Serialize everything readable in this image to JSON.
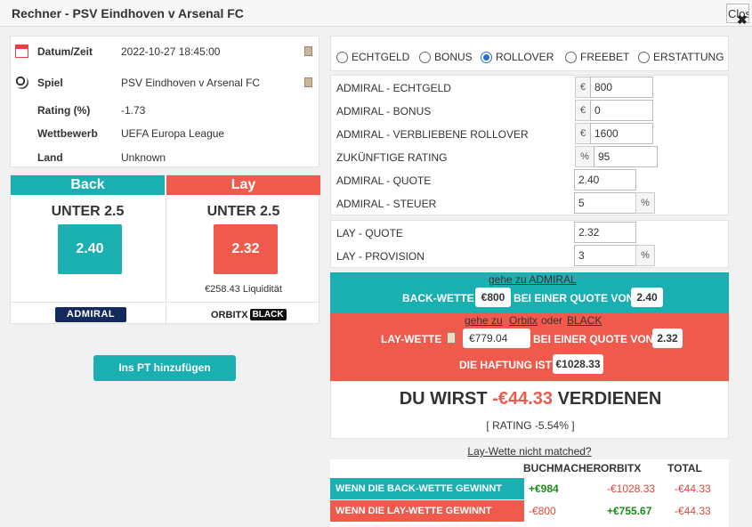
{
  "window": {
    "title": "Rechner - PSV Eindhoven v Arsenal FC",
    "close_label": "Close",
    "close_x": "✖"
  },
  "info": {
    "rows": [
      {
        "label": "Datum/Zeit",
        "value": "2022-10-27 18:45:00"
      },
      {
        "label": "Spiel",
        "value": "PSV Eindhoven v Arsenal FC"
      },
      {
        "label": "Rating (%)",
        "value": "-1.73"
      },
      {
        "label": "Wettbewerb",
        "value": "UEFA Europa League"
      },
      {
        "label": "Land",
        "value": "Unknown"
      }
    ]
  },
  "back": {
    "header": "Back",
    "market": "UNTER 2.5",
    "odds": "2.40",
    "bookmaker": "ADMIRAL"
  },
  "lay": {
    "header": "Lay",
    "market": "UNTER 2.5",
    "odds": "2.32",
    "liquidity": "€258.43 Liquidität",
    "exchange": "ORBITX",
    "exchange_x": "X",
    "exchange_black": "BLACK"
  },
  "pt_button": "Ins PT hinzufügen",
  "radios": [
    {
      "label": "ECHTGELD",
      "checked": false
    },
    {
      "label": "BONUS",
      "checked": false
    },
    {
      "label": "ROLLOVER",
      "checked": true
    },
    {
      "label": "FREEBET",
      "checked": false
    },
    {
      "label": "ERSTATTUNG",
      "checked": false
    }
  ],
  "form": {
    "echtgeld_label": "ADMIRAL - ECHTGELD",
    "echtgeld_addon": "€",
    "echtgeld_value": "800",
    "bonus_label": "ADMIRAL - BONUS",
    "bonus_addon": "€",
    "bonus_value": "0",
    "rollover_label": "ADMIRAL - VERBLIEBENE ROLLOVER",
    "rollover_addon": "€",
    "rollover_value": "1600",
    "rating_label": "ZUKÜNFTIGE RATING",
    "rating_addon": "%",
    "rating_value": "95",
    "quote_label": "ADMIRAL - QUOTE",
    "quote_value": "2.40",
    "steuer_label": "ADMIRAL - STEUER",
    "steuer_value": "5",
    "steuer_addon": "%",
    "lay_quote_label": "LAY - QUOTE",
    "lay_quote_value": "2.32",
    "provision_label": "LAY - PROVISION",
    "provision_value": "3",
    "provision_addon": "%"
  },
  "back_bet": {
    "link": "gehe zu ADMIRAL",
    "prefix": "BACK-WETTE",
    "stake": "€800",
    "middle": "BEI EINER QUOTE VON",
    "odds": "2.40"
  },
  "lay_bet": {
    "link_prefix": "gehe zu",
    "link_orbitx": "Orbitx",
    "link_or": "oder",
    "link_black": "BLACK",
    "prefix": "LAY-WETTE",
    "stake": "€779.04",
    "middle": "BEI EINER QUOTE VON",
    "odds": "2.32",
    "liability_label": "DIE HAFTUNG IST",
    "liability": "€1028.33"
  },
  "result": {
    "prefix": "DU WIRST",
    "amount": "-€44.33",
    "suffix": "VERDIENEN",
    "rating": "[ RATING -5.54% ]"
  },
  "not_matched": "Lay-Wette nicht matched?",
  "table": {
    "headers": [
      "BUCHMACHER",
      "ORBITX",
      "TOTAL"
    ],
    "rows": [
      {
        "label": "WENN DIE BACK-WETTE GEWINNT",
        "bookie": "+€984",
        "exchange": "-€1028.33",
        "total": "-€44.33"
      },
      {
        "label": "WENN DIE LAY-WETTE GEWINNT",
        "bookie": "-€800",
        "exchange": "+€755.67",
        "total": "-€44.33"
      }
    ]
  },
  "colors": {
    "teal": "#1aafb0",
    "red": "#ef5a4d",
    "admiral_blue": "#14295c",
    "positive": "#1a8a1a",
    "negative": "#d9473a"
  },
  "icons": {
    "date": "calendar-icon",
    "game": "football-icon",
    "copy": "copy-icon",
    "lay_copy": "clipboard-icon"
  }
}
